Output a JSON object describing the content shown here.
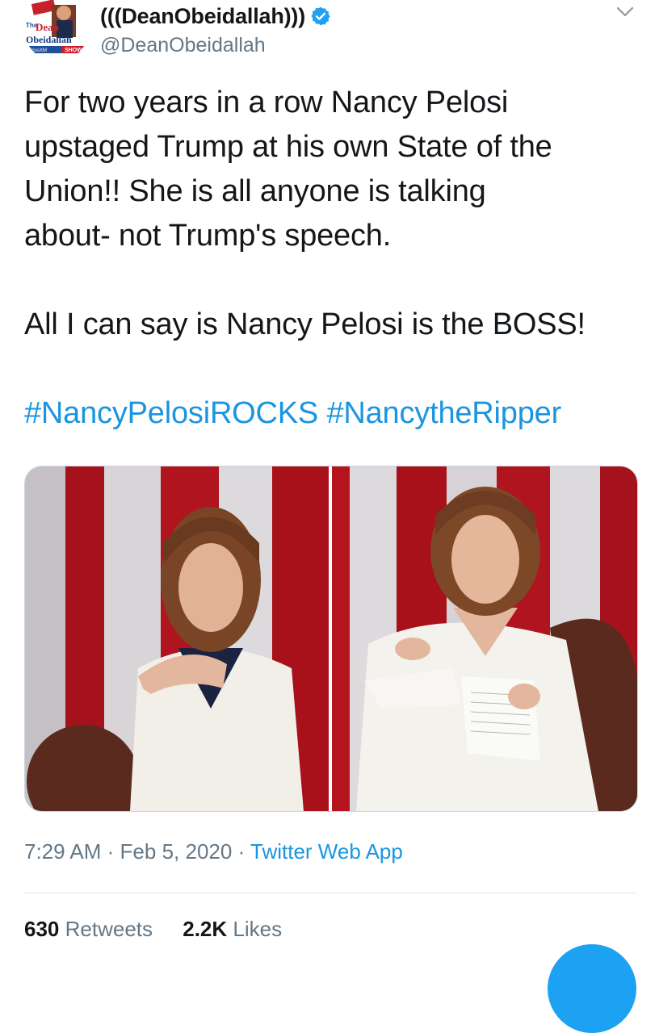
{
  "author": {
    "display_name": "(((DeanObeidallah)))",
    "handle": "@DeanObeidallah",
    "verified": true,
    "avatar_text": {
      "line1": "The",
      "line2": "Dean",
      "line3": "Obeidallah",
      "line4": "SHOW",
      "station": "SiriusXM"
    }
  },
  "tweet": {
    "text_lines": [
      "For two years in a row Nancy Pelosi",
      "upstaged Trump at his own State of the",
      "Union!! She is all anyone is talking",
      "about- not Trump's speech."
    ],
    "second_paragraph": "All I can say is Nancy Pelosi is the BOSS!",
    "hashtags": [
      "#NancyPelosiROCKS",
      "#NancytheRipper"
    ]
  },
  "media": {
    "count": 2
  },
  "meta": {
    "time": "7:29 AM",
    "separator": "·",
    "date": "Feb 5, 2020",
    "source": "Twitter Web App"
  },
  "stats": {
    "retweets_count": "630",
    "retweets_label": "Retweets",
    "likes_count": "2.2K",
    "likes_label": "Likes"
  },
  "colors": {
    "link": "#1b95e0",
    "secondary_text": "#657786",
    "primary_text": "#14171a",
    "verified": "#1da1f2"
  },
  "icons": {
    "verified": "verified-badge-icon",
    "menu": "chevron-down-icon"
  }
}
